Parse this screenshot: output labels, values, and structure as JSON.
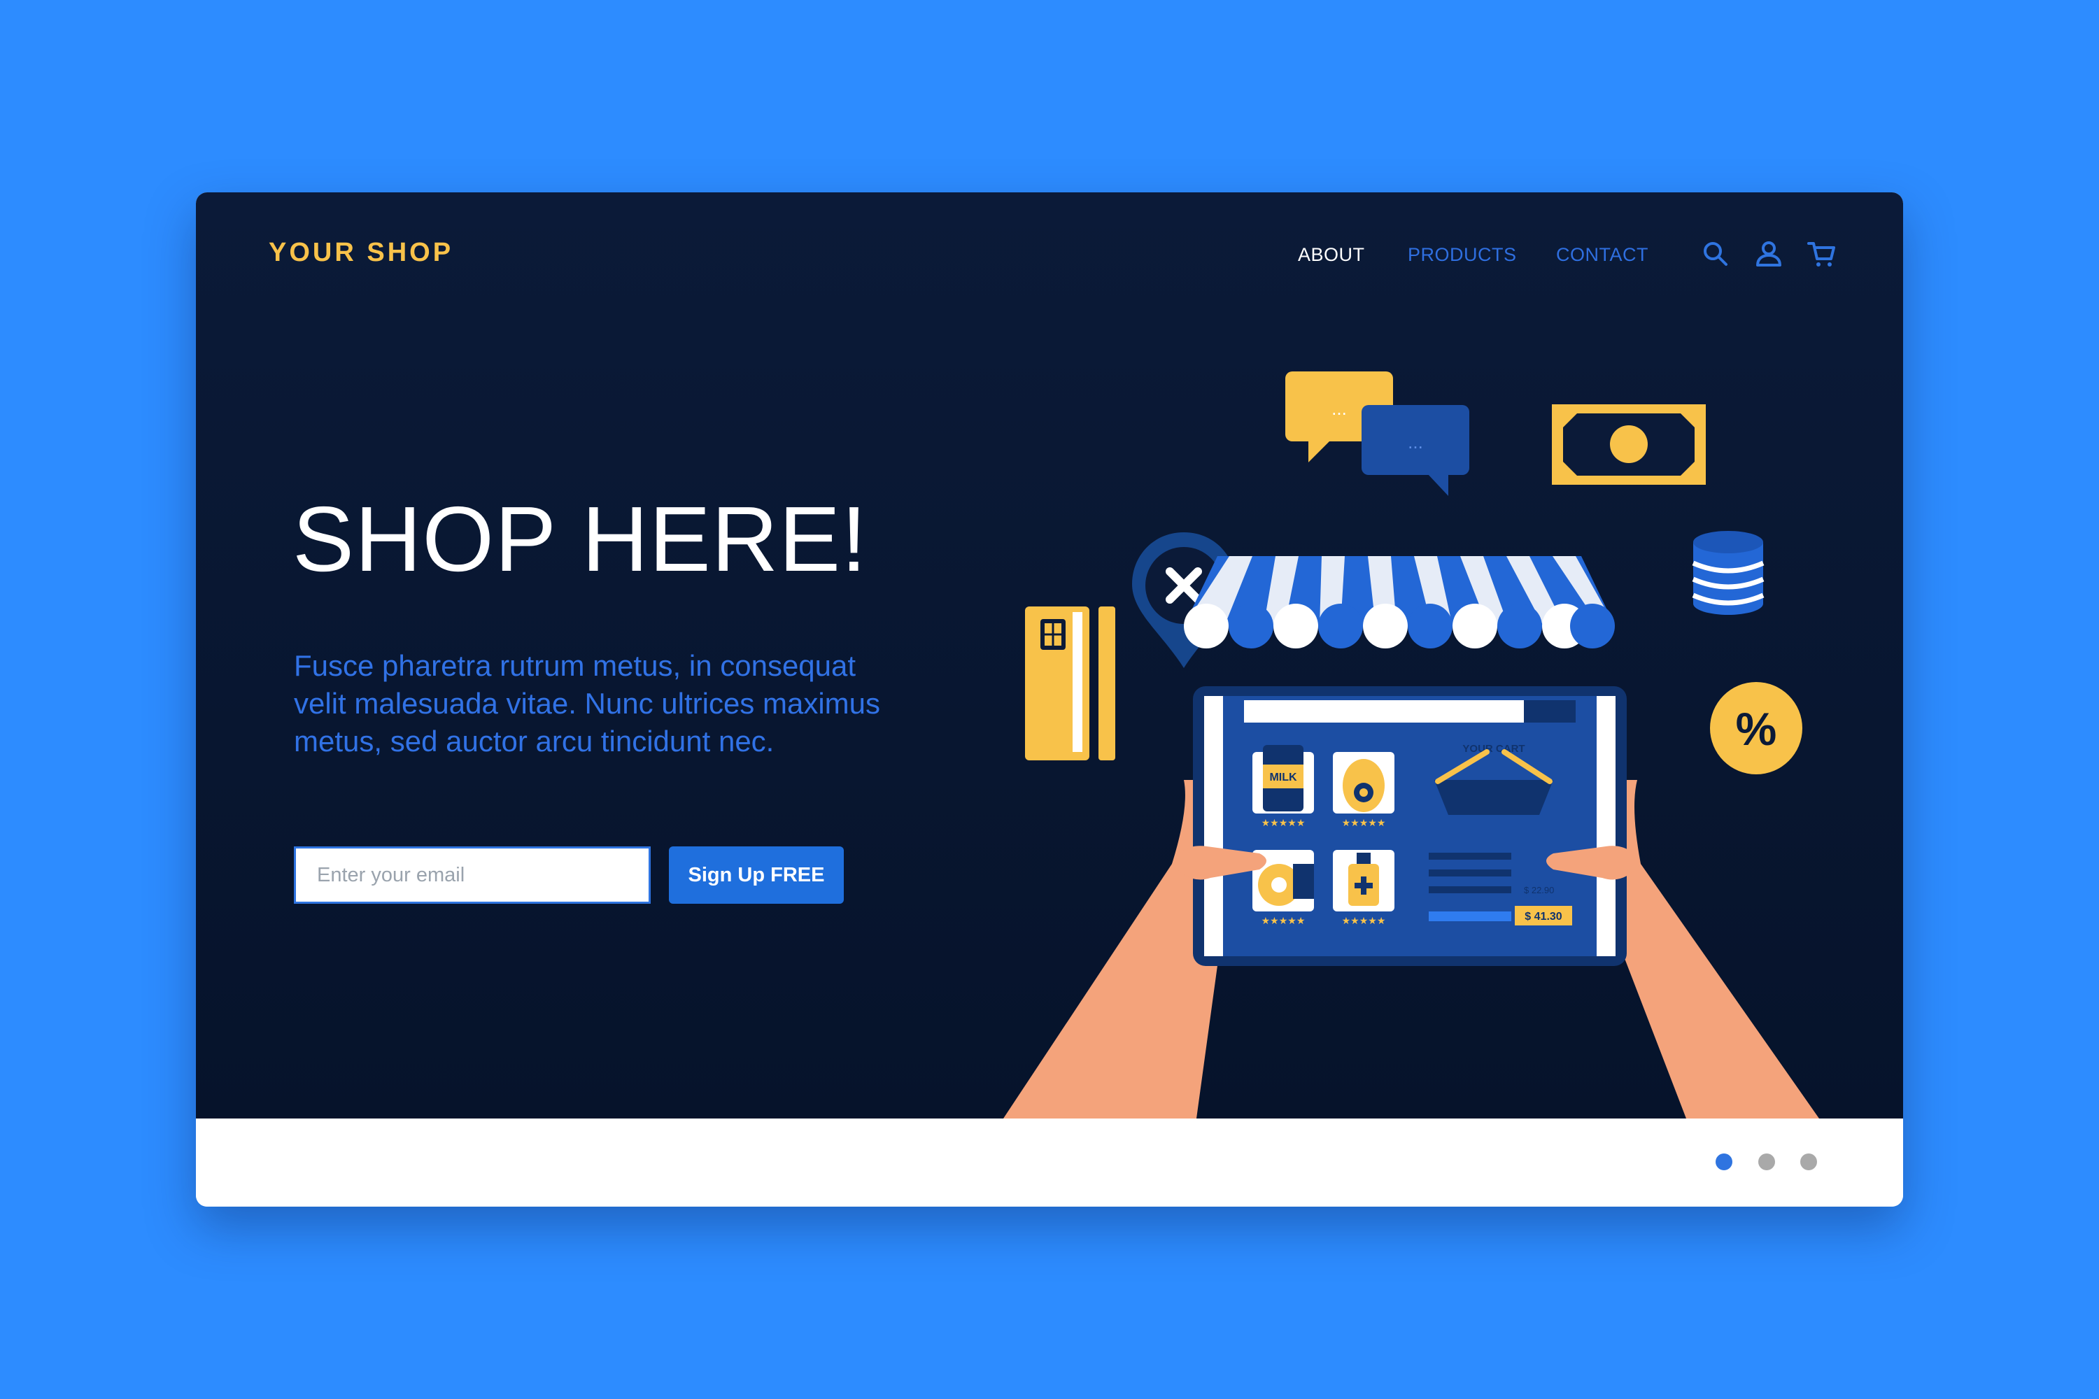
{
  "brand": {
    "name": "YOUR SHOP"
  },
  "nav": {
    "items": [
      {
        "label": "ABOUT",
        "active": true
      },
      {
        "label": "PRODUCTS",
        "active": false
      },
      {
        "label": "CONTACT",
        "active": false
      }
    ],
    "icons": [
      "search-icon",
      "user-icon",
      "cart-icon"
    ]
  },
  "hero": {
    "title": "SHOP HERE!",
    "subtitle": "Fusce pharetra rutrum metus, in consequat velit malesuada vitae. Nunc ultrices maximus metus, sed auctor arcu tincidunt nec."
  },
  "signup": {
    "email_placeholder": "Enter your email",
    "email_value": "",
    "button_label": "Sign Up FREE"
  },
  "illustration": {
    "product_label": "MILK",
    "cart_title": "YOUR CART",
    "cart_line_price": "$ 22.90",
    "cart_total": "$ 41.30",
    "percent_badge": "%",
    "chat_bubble_text": "...",
    "icons": [
      "close-pin-icon",
      "chat-bubbles-icon",
      "banknote-icon",
      "coins-icon",
      "percent-badge-icon",
      "credit-card-icon",
      "shop-awning-icon",
      "tablet-icon",
      "shopping-basket-icon"
    ]
  },
  "pagination": {
    "pages": 3,
    "current": 1
  },
  "colors": {
    "page_background": "#2d8cff",
    "hero_background": "#0b1a38",
    "accent_yellow": "#f8c24a",
    "accent_blue": "#1f6fdd",
    "nav_link": "#2f6fe0",
    "dot_active": "#2f74e0",
    "dot_inactive": "#a9a9a9"
  }
}
